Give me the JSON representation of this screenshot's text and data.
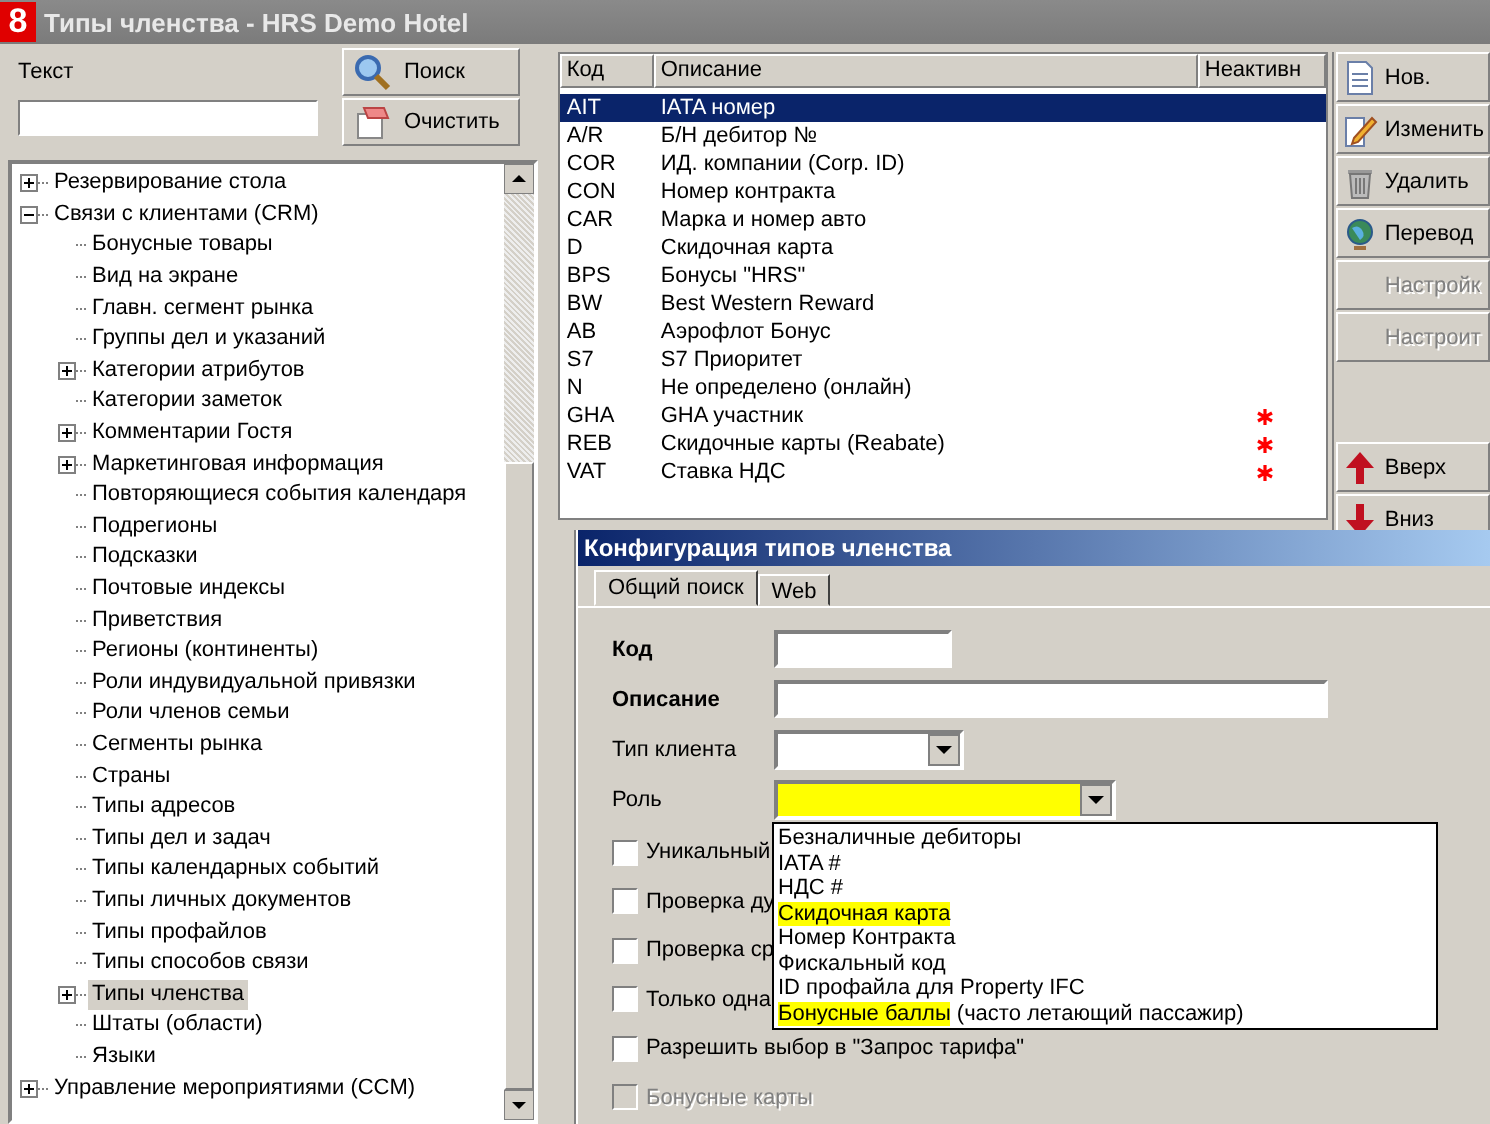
{
  "window": {
    "app_icon": "8",
    "title": "Типы членства - HRS Demo Hotel"
  },
  "search": {
    "label": "Текст",
    "buttons": [
      {
        "label": "Поиск",
        "kind": "search"
      },
      {
        "label": "Очистить",
        "kind": "clear"
      }
    ]
  },
  "tree": [
    {
      "label": "Резервирование стола",
      "expanded": false,
      "selected": false
    },
    {
      "label": "Связи с клиентами (CRM)",
      "expanded": true,
      "selected": false,
      "children": [
        {
          "label": "Бонусные товары",
          "selected": false
        },
        {
          "label": "Вид на экране",
          "selected": false
        },
        {
          "label": "Главн. сегмент рынка",
          "selected": false
        },
        {
          "label": "Группы дел и указаний",
          "selected": false
        },
        {
          "label": "Категории атрибутов",
          "expanded": false,
          "selected": false
        },
        {
          "label": "Категории заметок",
          "selected": false
        },
        {
          "label": "Комментарии Гостя",
          "expanded": false,
          "selected": false
        },
        {
          "label": "Маркетинговая информация",
          "expanded": false,
          "selected": false
        },
        {
          "label": "Повторяющиеся события календаря",
          "selected": false
        },
        {
          "label": "Подрегионы",
          "selected": false
        },
        {
          "label": "Подсказки",
          "selected": false
        },
        {
          "label": "Почтовые индексы",
          "selected": false
        },
        {
          "label": "Приветствия",
          "selected": false
        },
        {
          "label": "Регионы (континенты)",
          "selected": false
        },
        {
          "label": "Роли индувидуальной привязки",
          "selected": false
        },
        {
          "label": "Роли членов семьи",
          "selected": false
        },
        {
          "label": "Сегменты рынка",
          "selected": false
        },
        {
          "label": "Страны",
          "selected": false
        },
        {
          "label": "Типы адресов",
          "selected": false
        },
        {
          "label": "Типы дел и задач",
          "selected": false
        },
        {
          "label": "Типы календарных событий",
          "selected": false
        },
        {
          "label": "Типы личных документов",
          "selected": false
        },
        {
          "label": "Типы профайлов",
          "selected": false
        },
        {
          "label": "Типы способов связи",
          "selected": false
        },
        {
          "label": "Типы членства",
          "expanded": false,
          "selected": true
        },
        {
          "label": "Штаты (области)",
          "selected": false
        },
        {
          "label": "Языки",
          "selected": false
        }
      ]
    },
    {
      "label": "Управление мероприятиями (CCM)",
      "expanded": false,
      "selected": false
    }
  ],
  "table": {
    "columns": [
      "Код",
      "Описание",
      "Неактивн"
    ],
    "rows": [
      {
        "code": "AIT",
        "description": "IATA номер",
        "inactive": false,
        "selected": true
      },
      {
        "code": "A/R",
        "description": "Б/Н дебитор №",
        "inactive": false,
        "selected": false
      },
      {
        "code": "COR",
        "description": "ИД. компании (Corp. ID)",
        "inactive": false,
        "selected": false
      },
      {
        "code": "CON",
        "description": "Номер контракта",
        "inactive": false,
        "selected": false
      },
      {
        "code": "CAR",
        "description": "Марка и номер авто",
        "inactive": false,
        "selected": false
      },
      {
        "code": "D",
        "description": "Скидочная карта",
        "inactive": false,
        "selected": false
      },
      {
        "code": "BPS",
        "description": "Бонусы \"HRS\"",
        "inactive": false,
        "selected": false
      },
      {
        "code": "BW",
        "description": "Best Western Reward",
        "inactive": false,
        "selected": false
      },
      {
        "code": "AB",
        "description": "Аэрофлот Бонус",
        "inactive": false,
        "selected": false
      },
      {
        "code": "S7",
        "description": "S7 Приоритет",
        "inactive": false,
        "selected": false
      },
      {
        "code": "N",
        "description": "Не определено (онлайн)",
        "inactive": false,
        "selected": false
      },
      {
        "code": "GHA",
        "description": "GHA участник",
        "inactive": true,
        "selected": false
      },
      {
        "code": "REB",
        "description": "Скидочные карты (Reabate)",
        "inactive": true,
        "selected": false
      },
      {
        "code": "VAT",
        "description": "Ставка НДС",
        "inactive": true,
        "selected": false
      }
    ]
  },
  "actions": [
    {
      "label": "Нов.",
      "kind": "new",
      "disabled": false
    },
    {
      "label": "Изменить",
      "kind": "edit",
      "disabled": false
    },
    {
      "label": "Удалить",
      "kind": "delete",
      "disabled": false
    },
    {
      "label": "Перевод",
      "kind": "translate",
      "disabled": false
    },
    {
      "label": "Настройк",
      "kind": "plain",
      "disabled": true
    },
    {
      "label": "Настроит",
      "kind": "plain",
      "disabled": true
    }
  ],
  "move_actions": [
    {
      "label": "Вверх",
      "kind": "up",
      "disabled": false
    },
    {
      "label": "Вниз",
      "kind": "down",
      "disabled": false
    }
  ],
  "dialog": {
    "title": "Конфигурация типов членства",
    "tabs": [
      {
        "label": "Общий поиск",
        "selected": true
      },
      {
        "label": "Web",
        "selected": false
      }
    ],
    "fields": [
      {
        "label": "Код",
        "kind": "short_text",
        "required": true
      },
      {
        "label": "Описание",
        "kind": "long_text",
        "required": true
      },
      {
        "label": "Тип клиента",
        "kind": "short_combo",
        "required": false
      },
      {
        "label": "Роль",
        "kind": "combo",
        "required": false,
        "highlighted": true
      }
    ],
    "dropdown": [
      {
        "parts": [
          {
            "text": "Безналичные дебиторы",
            "highlighted": false
          }
        ]
      },
      {
        "parts": [
          {
            "text": "IATA #",
            "highlighted": false
          }
        ]
      },
      {
        "parts": [
          {
            "text": "НДС #",
            "highlighted": false
          }
        ]
      },
      {
        "parts": [
          {
            "text": "Скидочная карта",
            "highlighted": true
          }
        ]
      },
      {
        "parts": [
          {
            "text": "Номер Контракта",
            "highlighted": false
          }
        ]
      },
      {
        "parts": [
          {
            "text": "Фискальный код",
            "highlighted": false
          }
        ]
      },
      {
        "parts": [
          {
            "text": "ID профайла для Property IFC",
            "highlighted": false
          }
        ]
      },
      {
        "parts": [
          {
            "text": "Бонусные баллы",
            "highlighted": true
          },
          {
            "text": " (часто летающий пассажир)",
            "highlighted": false
          }
        ]
      }
    ],
    "checkboxes": [
      {
        "label": "Уникальный",
        "checked": false,
        "disabled": false
      },
      {
        "label": "Проверка ду",
        "checked": false,
        "disabled": false
      },
      {
        "label": "Проверка ср",
        "checked": false,
        "disabled": false
      },
      {
        "label": "Только одна",
        "checked": false,
        "disabled": false
      },
      {
        "label": "Разрешить выбор в \"Запрос тарифа\"",
        "checked": false,
        "disabled": false
      },
      {
        "label": "Бонусные карты",
        "checked": false,
        "disabled": true
      }
    ]
  }
}
